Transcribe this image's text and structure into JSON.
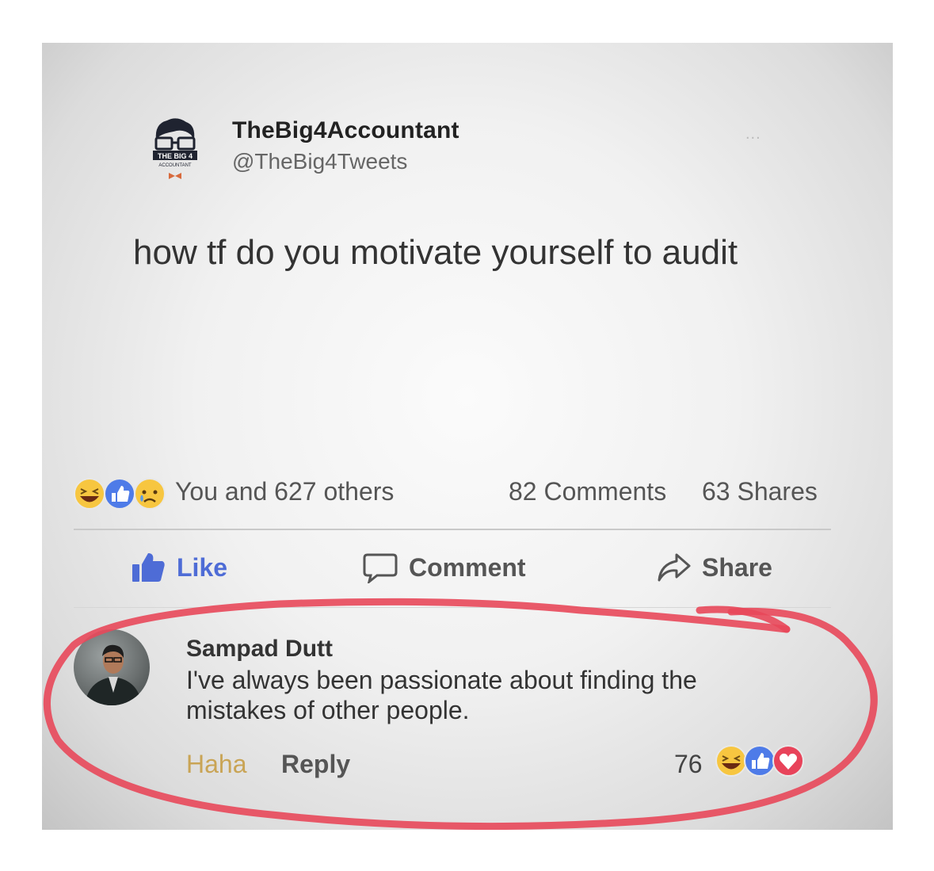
{
  "post": {
    "author_name": "TheBig4Accountant",
    "author_handle": "@TheBig4Tweets",
    "logo_text_line1": "THE BIG 4",
    "logo_text_line2": "ACCOUNTANT",
    "more_label": "...",
    "text": "how tf do you motivate yourself to audit"
  },
  "stats": {
    "reaction_icons": [
      "haha-icon",
      "like-icon",
      "sad-icon"
    ],
    "reaction_text": "You and 627 others",
    "comments": "82 Comments",
    "shares": "63 Shares"
  },
  "actions": {
    "like": "Like",
    "comment": "Comment",
    "share": "Share"
  },
  "comment": {
    "author": "Sampad Dutt",
    "text_line1": "I've always been passionate about finding the",
    "text_line2": "mistakes of other people.",
    "haha_label": "Haha",
    "reply_label": "Reply",
    "reaction_count": "76",
    "reaction_icons": [
      "haha-icon",
      "like-icon",
      "love-icon"
    ]
  },
  "colors": {
    "like_blue": "#4e6cd6",
    "annotation_red": "#e8485a",
    "haha_yellow": "#f7c640",
    "love_red": "#e8435a"
  }
}
